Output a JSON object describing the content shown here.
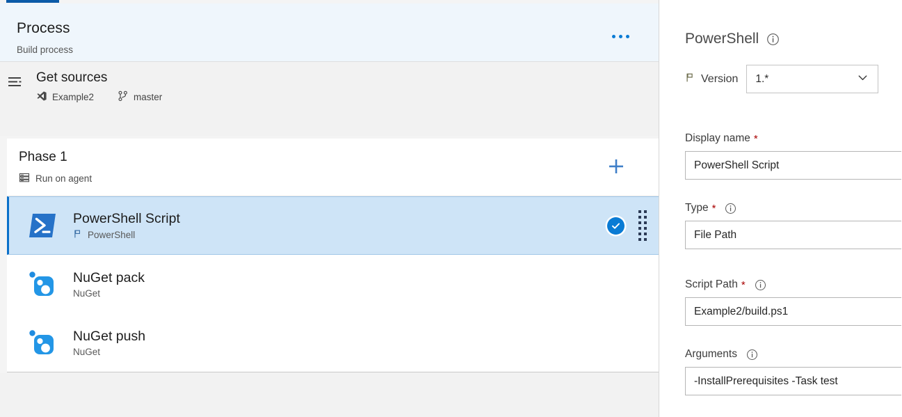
{
  "left": {
    "process": {
      "title": "Process",
      "subtitle": "Build process",
      "menu_icon": "ellipsis-icon"
    },
    "get_sources": {
      "title": "Get sources",
      "icon": "get-sources-icon",
      "repository": "Example2",
      "repository_icon": "visual-studio-repo-icon",
      "branch": "master",
      "branch_icon": "git-branch-icon"
    },
    "phase": {
      "title": "Phase 1",
      "subtitle": "Run on agent",
      "subtitle_icon": "agent-server-icon",
      "add_label": "+",
      "add_icon": "plus-icon"
    },
    "tasks": [
      {
        "name": "PowerShell Script",
        "subtitle": "PowerShell",
        "subtitle_icon": "flag-icon",
        "icon": "powershell-icon",
        "selected": true,
        "status_icon": "check-circle-icon"
      },
      {
        "name": "NuGet pack",
        "subtitle": "NuGet",
        "subtitle_icon": "",
        "icon": "nuget-icon",
        "selected": false,
        "status_icon": ""
      },
      {
        "name": "NuGet push",
        "subtitle": "NuGet",
        "subtitle_icon": "",
        "icon": "nuget-icon",
        "selected": false,
        "status_icon": ""
      }
    ]
  },
  "right": {
    "title": "PowerShell",
    "title_info_icon": "info-icon",
    "version": {
      "label": "Version",
      "label_icon": "flag-icon",
      "value": "1.*",
      "chevron_icon": "chevron-down-icon"
    },
    "fields": [
      {
        "label": "Display name",
        "required": "*",
        "info": false,
        "value": "PowerShell Script"
      },
      {
        "label": "Type",
        "required": "*",
        "info": true,
        "value": "File Path"
      },
      {
        "label": "Script Path",
        "required": "*",
        "info": true,
        "value": "Example2/build.ps1"
      },
      {
        "label": "Arguments",
        "required": "",
        "info": true,
        "value": "-InstallPrerequisites -Task test"
      }
    ]
  },
  "colors": {
    "accent": "#0b5ba8",
    "link_blue": "#0a7bd4",
    "selected_row": "#cee4f7",
    "header_bg": "#eff6fc",
    "required_red": "#a80000"
  }
}
